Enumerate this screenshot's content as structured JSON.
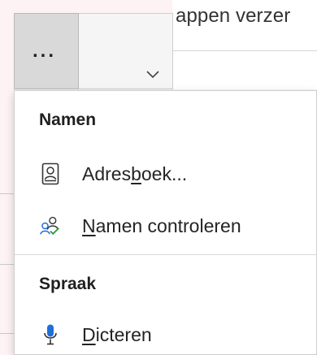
{
  "background": {
    "title_fragment": "appen verzer"
  },
  "toolbar": {
    "more_button_label": "..."
  },
  "menu": {
    "sections": [
      {
        "header": "Namen",
        "items": [
          {
            "pre": "Adres",
            "key": "b",
            "post": "oek...",
            "icon": "address-book-icon"
          },
          {
            "pre": "",
            "key": "N",
            "post": "amen controleren",
            "icon": "check-names-icon"
          }
        ]
      },
      {
        "header": "Spraak",
        "items": [
          {
            "pre": "",
            "key": "D",
            "post": "icteren",
            "icon": "microphone-icon"
          }
        ]
      }
    ]
  },
  "colors": {
    "accent_blue": "#1f6fd8",
    "check_green": "#2e9a4a",
    "menu_bg": "#ffffff",
    "page_bg": "#fdf2f4"
  }
}
